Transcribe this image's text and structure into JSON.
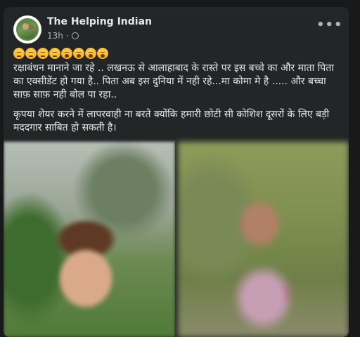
{
  "post": {
    "page_name": "The Helping Indian",
    "time": "13h",
    "separator": "·",
    "audience_icon": "globe-icon",
    "more_icon": "more-dots-icon",
    "more_label": "•••",
    "emoji_reactions": [
      "sad-face",
      "sad-face",
      "sad-face",
      "sad-face",
      "crying-face",
      "crying-face",
      "crying-face",
      "crying-face"
    ],
    "paragraph_1": "रक्षाबंधन मानाने जा रहे .. लखनऊ से आलाहाबाद के रास्ते पर इस बच्चे का और माता पिता का एक्सीडेंट हो गया है..  पिता अब इस दुनिया में नही रहे...मा कोमा मे है ..... और बच्चा साफ़ साफ़ नही बोल पा रहा..",
    "paragraph_2": "कृपया शेयर करने में लापरवाही ना बरते क्योंकि हमारी छोटी सी कोशिश दूसरों के लिए बड़ी मददगार साबित हो सकती है।"
  },
  "colors": {
    "background": "#18191a",
    "card": "#242526",
    "primary_text": "#e4e6eb",
    "secondary_text": "#b0b3b8"
  }
}
